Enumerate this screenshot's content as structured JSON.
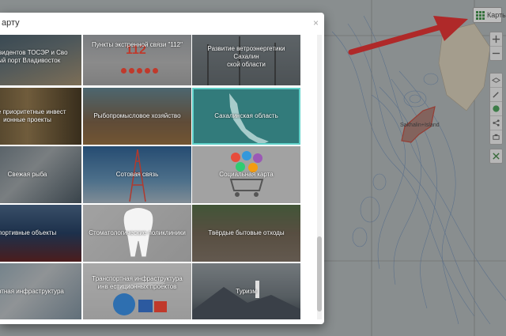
{
  "toolbar": {
    "maps_label": "Карты"
  },
  "map": {
    "label_text": "Sakhalin+Island"
  },
  "modal": {
    "title": "арту",
    "close_symbol": "×",
    "tiles": [
      {
        "label": "ь резидентов ТОСЭР и Сво\nный порт Владивосток",
        "selected": false
      },
      {
        "label": "Пункты экстренной связи \"112\"",
        "selected": false
      },
      {
        "label": "Развитие ветроэнергетики Сахалин\nской области",
        "selected": false
      },
      {
        "label": "мые приоритетные инвест\nионные проекты",
        "selected": false
      },
      {
        "label": "Рыбопромысловое хозяйство",
        "selected": false
      },
      {
        "label": "Сахалинская область",
        "selected": true
      },
      {
        "label": "Свежая рыба",
        "selected": false
      },
      {
        "label": "Сотовая связь",
        "selected": false
      },
      {
        "label": "Социальная карта",
        "selected": false
      },
      {
        "label": "портивные объекты",
        "selected": false
      },
      {
        "label": "Стоматологические поликлиники",
        "selected": false
      },
      {
        "label": "Твёрдые бытовые отходы",
        "selected": false
      },
      {
        "label": "портная инфраструктура",
        "selected": false
      },
      {
        "label": "Транспортная инфраструктура инв\nестиционных проектов",
        "selected": false
      },
      {
        "label": "Туризм",
        "selected": false
      }
    ]
  },
  "colors": {
    "selected_border": "#5fd0c8",
    "arrow": "#e81b1b",
    "island_outline": "#c0392b"
  }
}
